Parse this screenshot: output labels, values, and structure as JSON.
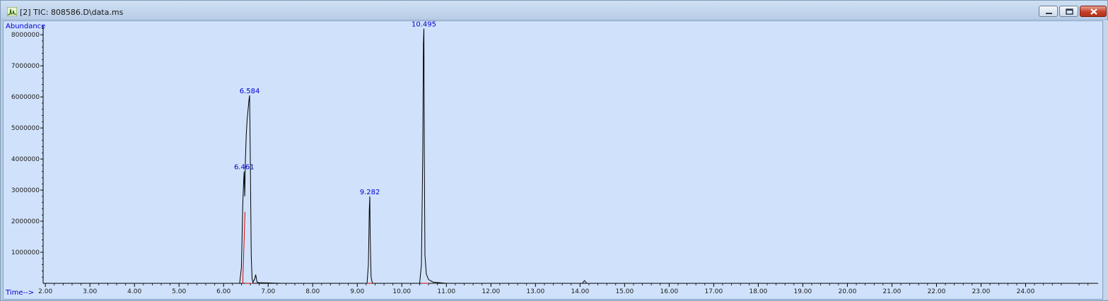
{
  "window": {
    "title": "[2] TIC: 808586.D\\data.ms",
    "icons": [
      "chromatogram-app-icon",
      "minimize-icon",
      "maximize-icon",
      "close-icon"
    ],
    "colors": {
      "plot_background": "#d0e2fb",
      "trace": "#000000",
      "baseline": "#e00000",
      "labels": "#0000d0"
    }
  },
  "chart_data": {
    "type": "line",
    "title": "",
    "xlabel": "Time-->",
    "ylabel": "Abundance",
    "xlim": [
      1.95,
      25.5
    ],
    "ylim": [
      0,
      8300000
    ],
    "grid": false,
    "legend": "none",
    "x_ticks": [
      2.0,
      3.0,
      4.0,
      5.0,
      6.0,
      7.0,
      8.0,
      9.0,
      10.0,
      11.0,
      12.0,
      13.0,
      14.0,
      15.0,
      16.0,
      17.0,
      18.0,
      19.0,
      20.0,
      21.0,
      22.0,
      23.0,
      24.0
    ],
    "x_tick_labels": [
      "2.00",
      "3.00",
      "4.00",
      "5.00",
      "6.00",
      "7.00",
      "8.00",
      "9.00",
      "10.00",
      "11.00",
      "12.00",
      "13.00",
      "14.00",
      "15.00",
      "16.00",
      "17.00",
      "18.00",
      "19.00",
      "20.00",
      "21.00",
      "22.00",
      "23.00",
      "24.00"
    ],
    "y_ticks": [
      1000000,
      2000000,
      3000000,
      4000000,
      5000000,
      6000000,
      7000000,
      8000000
    ],
    "y_tick_labels": [
      "1000000",
      "2000000",
      "3000000",
      "4000000",
      "5000000",
      "6000000",
      "7000000",
      "8000000"
    ],
    "series": [
      {
        "x": [
          2.0,
          6.36,
          6.4,
          6.43,
          6.45,
          6.461,
          6.475,
          6.49,
          6.51,
          6.53,
          6.55,
          6.57,
          6.584,
          6.6,
          6.62,
          6.64,
          6.66,
          6.7,
          6.72,
          6.75,
          6.8,
          7.3,
          9.22,
          9.25,
          9.27,
          9.282,
          9.29,
          9.31,
          9.34,
          10.4,
          10.44,
          10.47,
          10.485,
          10.495,
          10.505,
          10.52,
          10.55,
          10.6,
          10.7,
          11.0,
          14.05,
          14.1,
          14.15,
          25.4
        ],
        "y": [
          0,
          0,
          500000,
          2500000,
          3300000,
          3600000,
          2800000,
          4000000,
          4800000,
          5300000,
          5600000,
          5900000,
          6050000,
          4000000,
          900000,
          150000,
          30000,
          150000,
          280000,
          40000,
          20000,
          0,
          0,
          600000,
          2400000,
          2800000,
          1600000,
          200000,
          0,
          0,
          600000,
          4200000,
          7700000,
          8200000,
          4100000,
          900000,
          300000,
          120000,
          40000,
          0,
          0,
          90000,
          0,
          0
        ]
      }
    ],
    "baselines": [
      {
        "x": [
          6.43,
          6.48
        ],
        "y": [
          0,
          2300000
        ]
      },
      {
        "x": [
          6.48,
          6.65
        ],
        "y": [
          0,
          0
        ]
      },
      {
        "x": [
          9.22,
          9.34
        ],
        "y": [
          0,
          0
        ]
      },
      {
        "x": [
          10.44,
          10.6
        ],
        "y": [
          0,
          0
        ]
      }
    ],
    "annotations": [
      {
        "text": "6.461",
        "x": 6.461,
        "y": 3600000
      },
      {
        "text": "6.584",
        "x": 6.584,
        "y": 6050000
      },
      {
        "text": "9.282",
        "x": 9.282,
        "y": 2800000
      },
      {
        "text": "10.495",
        "x": 10.495,
        "y": 8200000
      }
    ]
  }
}
